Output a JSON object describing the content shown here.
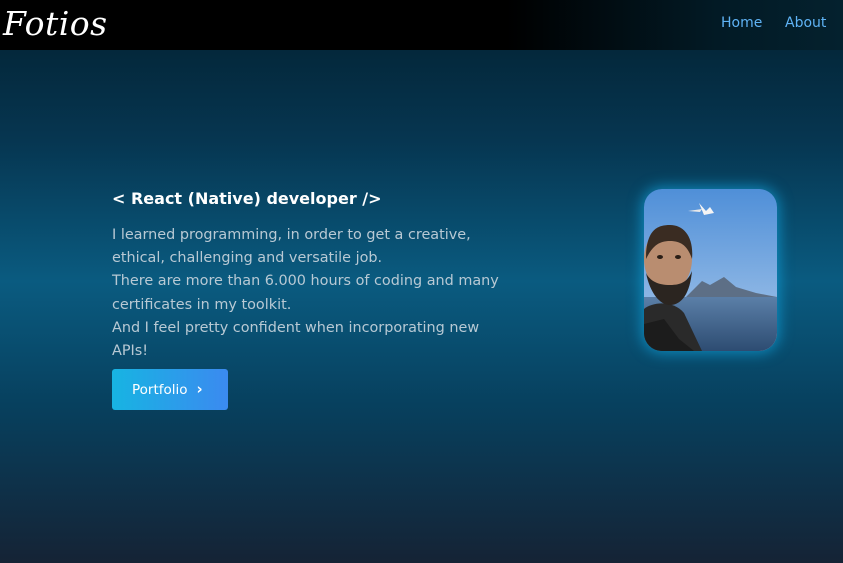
{
  "navbar": {
    "logo": "Fotios",
    "links": [
      {
        "label": "Home"
      },
      {
        "label": "About"
      }
    ]
  },
  "hero": {
    "heading": "< React (Native) developer />",
    "intro_lines": [
      "I learned programming, in order to get a creative,",
      "ethical, challenging and versatile job.",
      "There are more than 6.000 hours of coding and many",
      "certificates in my toolkit.",
      "And I feel pretty confident when incorporating new",
      "APIs!"
    ],
    "button_label": "Portfolio",
    "button_icon": "chevron-right-icon"
  },
  "colors": {
    "accent_link": "#5fb3f5",
    "button_start": "#17b4e2",
    "button_end": "#3b8af0"
  }
}
